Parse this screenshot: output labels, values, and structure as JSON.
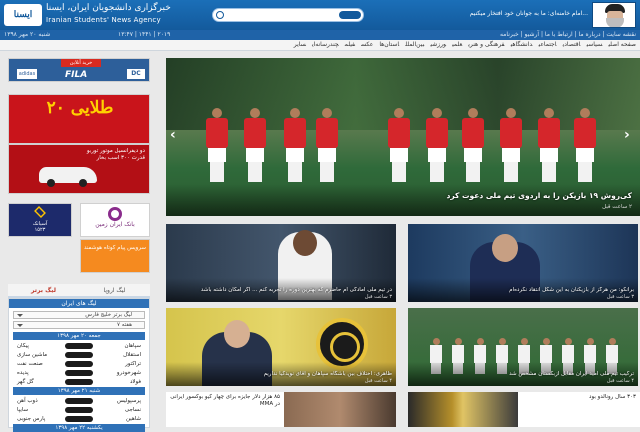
{
  "header": {
    "logo_badge": "ایسنا",
    "logo_title": "خبرگزاری دانشجویان ایران، ایسنا",
    "logo_subtitle": "Iranian Students' News Agency",
    "search_placeholder": "",
    "quote": "...امام خامنه‌ای: ما به جوانان خود افتخار میکنیم"
  },
  "subbar": {
    "date": "شنبه ۲۰ مهر ۱۳۹۸",
    "stats": "۱۳:۴۷ | ۱۴۴۱ | ۲۰۱۹",
    "links": "نقشه سایت | درباره ما | ارتباط با ما | آرشیو | خبرنامه"
  },
  "menu": {
    "items": [
      "صفحه اصلی",
      "سیاسی",
      "اقتصادی",
      "اجتماعی",
      "دانشگاهی",
      "فرهنگی و هنری",
      "علمی",
      "ورزشی",
      "بین‌الملل",
      "استان‌ها",
      "عکس",
      "فیلم",
      "چندرسانه‌ای",
      "سایر"
    ],
    "sub_active": "فوتبال ایران"
  },
  "sidebar": {
    "fila": {
      "tag": "خرید آنلاین",
      "brand1": "DC",
      "brand2": "FILA",
      "brand3": "adidas"
    },
    "gold": {
      "text": "۲۰ طلایی"
    },
    "car": {
      "text": "دو دیفرانسیل موتور توربو قدرت ۳۰۰ اسب بخار"
    },
    "ad_blue": "آسیاتک",
    "ad_blue_num": "۱۵۲۳",
    "ad_bank": "بانک ایران زمین",
    "ad_orange": "سرویس پیام کوتاه هوشمند",
    "tabs": [
      "لیگ برتر",
      "لیگ اروپا"
    ],
    "widget_title": "لیگ های ایران",
    "league_select": "لیگ برتر خلیج فارس",
    "week_select": "هفته ۷",
    "days": [
      {
        "header": "جمعه ۲۰ مهر ۱۳۹۸",
        "matches": [
          {
            "home": "سپاهان",
            "away": "پیکان"
          },
          {
            "home": "استقلال",
            "away": "ماشین سازی"
          },
          {
            "home": "تراکتور",
            "away": "صنعت نفت"
          },
          {
            "home": "شهرخودرو",
            "away": "پدیده"
          },
          {
            "home": "فولاد",
            "away": "گل گهر"
          }
        ]
      },
      {
        "header": "شنبه ۲۱ مهر ۱۳۹۸",
        "matches": [
          {
            "home": "پرسپولیس",
            "away": "ذوب آهن"
          },
          {
            "home": "نساجی",
            "away": "سایپا"
          },
          {
            "home": "شاهین",
            "away": "پارس جنوبی"
          }
        ]
      },
      {
        "header": "یکشنبه ۲۲ مهر ۱۳۹۸",
        "matches": []
      }
    ]
  },
  "hero": {
    "caption": "کی‌روش ۱۹ بازیکن را به اردوی تیم ملی دعوت کرد",
    "time": "۲ ساعت قبل"
  },
  "cards": [
    {
      "caption": "در تیم ملی آمادگی ام حاضرم که بهترین دوره را تجربه کنم ... اگر امکان داشته باشد",
      "time": "۳ ساعت قبل"
    },
    {
      "caption": "برانکو: من هرگز از بازیکنان به این شکل انتقاد نکرده‌ام",
      "time": "۳ ساعت قبل"
    },
    {
      "caption": "ظاهری: اختلاف بین باشگاه سپاهان و آقای نویدکیا نداریم",
      "time": "۴ ساعت قبل"
    },
    {
      "caption": "ترکیب تیم ملی امید ایران مقابل ازبکستان مشخص شد",
      "time": "۴ ساعت قبل"
    }
  ],
  "row5": [
    {
      "text": "۸۵ هزار دلار جایزه برای چهار کیو بوکسور ایرانی در MMA"
    },
    {
      "text": "۳۰۳ سال رونالدو بود"
    }
  ]
}
